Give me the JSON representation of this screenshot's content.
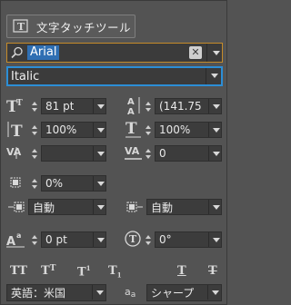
{
  "toolbar": {
    "touch_tool_label": "文字タッチツール"
  },
  "font": {
    "family_value": "Arial",
    "style_value": "Italic",
    "clear_glyph": "✕"
  },
  "metrics": {
    "font_size": "81 pt",
    "leading": "(141.75",
    "vertical_scale": "100%",
    "horizontal_scale": "100%",
    "kerning": "",
    "tracking": "0",
    "tsume": "0%",
    "aki_left": "自動",
    "aki_right": "自動",
    "baseline_shift": "0 pt",
    "rotation": "0°"
  },
  "bottom": {
    "language": "英語：米国",
    "aa_label": "a a",
    "antialias": "シャープ"
  },
  "icons": {
    "font_size": "T",
    "leading": "A",
    "vscale": "T",
    "hscale": "T",
    "kerning": "VA",
    "tracking": "VA",
    "baseline": "A",
    "rotate": "T"
  },
  "style_buttons": [
    "TT",
    "Tт",
    "T",
    "T",
    "T",
    "T"
  ]
}
